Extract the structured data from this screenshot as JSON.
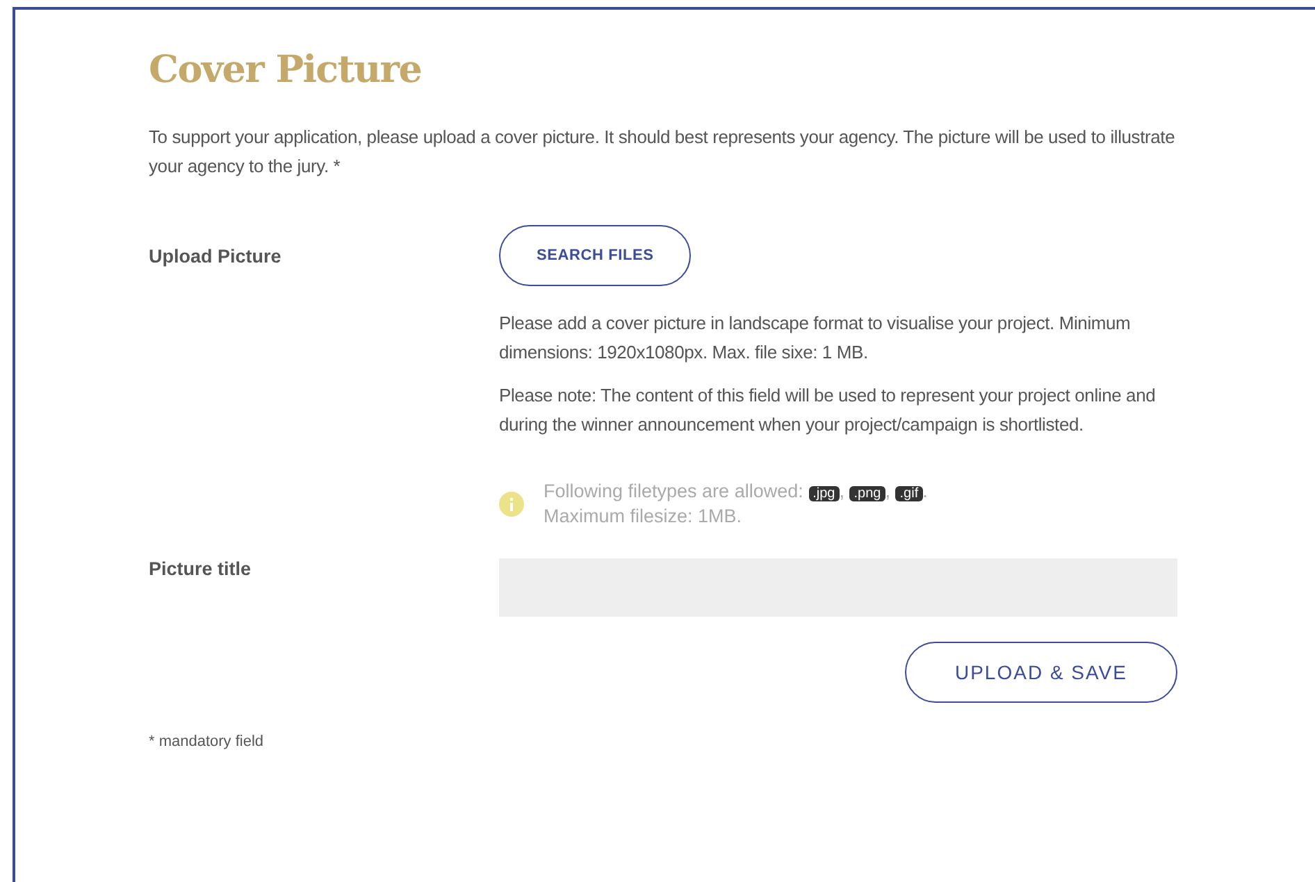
{
  "title": "Cover Picture",
  "intro": "To support your application, please upload a cover picture. It should best represents your agency. The picture will be used to illustrate your agency to the jury. *",
  "upload": {
    "label": "Upload Picture",
    "button": "SEARCH FILES",
    "notes": [
      "Please add a cover picture in landscape format to visualise your project. Minimum dimensions: 1920x1080px. Max. file sixe: 1 MB.",
      "Please note: The content of this field will be used to represent your project online and during the winner announcement when your project/campaign is shortlisted."
    ],
    "info": {
      "prefix": "Following filetypes are allowed:",
      "types": [
        {
          "label": ".jpg",
          "separator": ","
        },
        {
          "label": ".png",
          "separator": ","
        },
        {
          "label": ".gif",
          "separator": "."
        }
      ],
      "line2": "Maximum filesize: 1MB."
    }
  },
  "picture_title": {
    "label": "Picture title"
  },
  "save_button": "UPLOAD & SAVE",
  "footnote": "* mandatory field"
}
